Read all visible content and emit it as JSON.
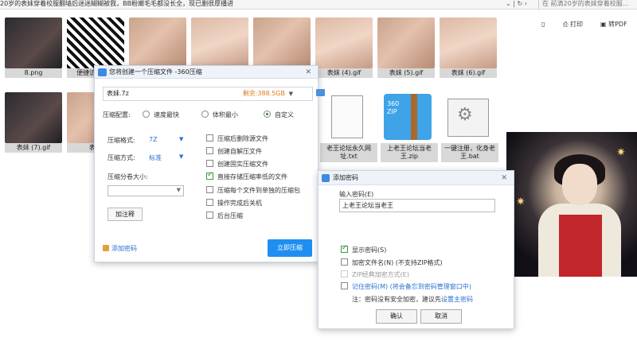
{
  "window": {
    "title": "20岁的表妹穿着校服翻墙后迷迷糊糊被我，BB粉嫩毛毛都没长全，现已删很厚播进",
    "search_placeholder": "在 前滴20岁的表妹穿着校服..."
  },
  "toolbar": {
    "print_label": "打印",
    "pdf_label": "转PDF"
  },
  "tiles": [
    {
      "label": "8.png"
    },
    {
      "label": "便捷访问...坛"
    },
    {
      "label": ""
    },
    {
      "label": ""
    },
    {
      "label": ""
    },
    {
      "label": "表妹 (4).gif"
    },
    {
      "label": "表妹 (5).gif"
    },
    {
      "label": "表妹 (6).gif"
    },
    {
      "label": "表妹 (7).gif"
    },
    {
      "label": "表妹"
    },
    {
      "label": "老王论坛永久网址.txt"
    },
    {
      "label": "上老王论坛当老王.zip"
    },
    {
      "label": "一键注册，化身老王.bat"
    }
  ],
  "zip_icon": {
    "line1": "360",
    "line2": "ZIP"
  },
  "compress_dialog": {
    "title": "您将创建一个压缩文件 -360压缩",
    "filename": "表妹.7z",
    "free_space": "剩余:388.5GB",
    "config_label": "压缩配置:",
    "config_options": [
      "速度最快",
      "体积最小",
      "自定义"
    ],
    "format_label": "压缩格式:",
    "format_value": "7Z",
    "method_label": "压缩方式:",
    "method_value": "标准",
    "split_label": "压缩分卷大小:",
    "comment_button": "加注释",
    "options": [
      {
        "label": "压缩后删除源文件",
        "checked": false
      },
      {
        "label": "创建自解压文件",
        "checked": false
      },
      {
        "label": "创建固实压缩文件",
        "checked": false
      },
      {
        "label": "直接存储压缩率低的文件",
        "checked": true
      },
      {
        "label": "压缩每个文件到单独的压缩包",
        "checked": false
      },
      {
        "label": "操作完成后关机",
        "checked": false
      },
      {
        "label": "后台压缩",
        "checked": false
      }
    ],
    "add_password": "添加密码",
    "compress_button": "立即压缩"
  },
  "password_dialog": {
    "title": "添加密码",
    "input_label": "输入密码(E)",
    "password_value": "上老王论坛当老王",
    "show_password": "显示密码(S)",
    "encrypt_names": "加密文件名(N) (不支持ZIP格式)",
    "zip_classic": "ZIP经典加密方式(E)",
    "remember": "记住密码(M) (将会备忘到密码管理窗口中)",
    "note_prefix": "注：密码没有安全加密，建议先",
    "note_link": "设置主密码",
    "ok_button": "确认",
    "cancel_button": "取消"
  }
}
